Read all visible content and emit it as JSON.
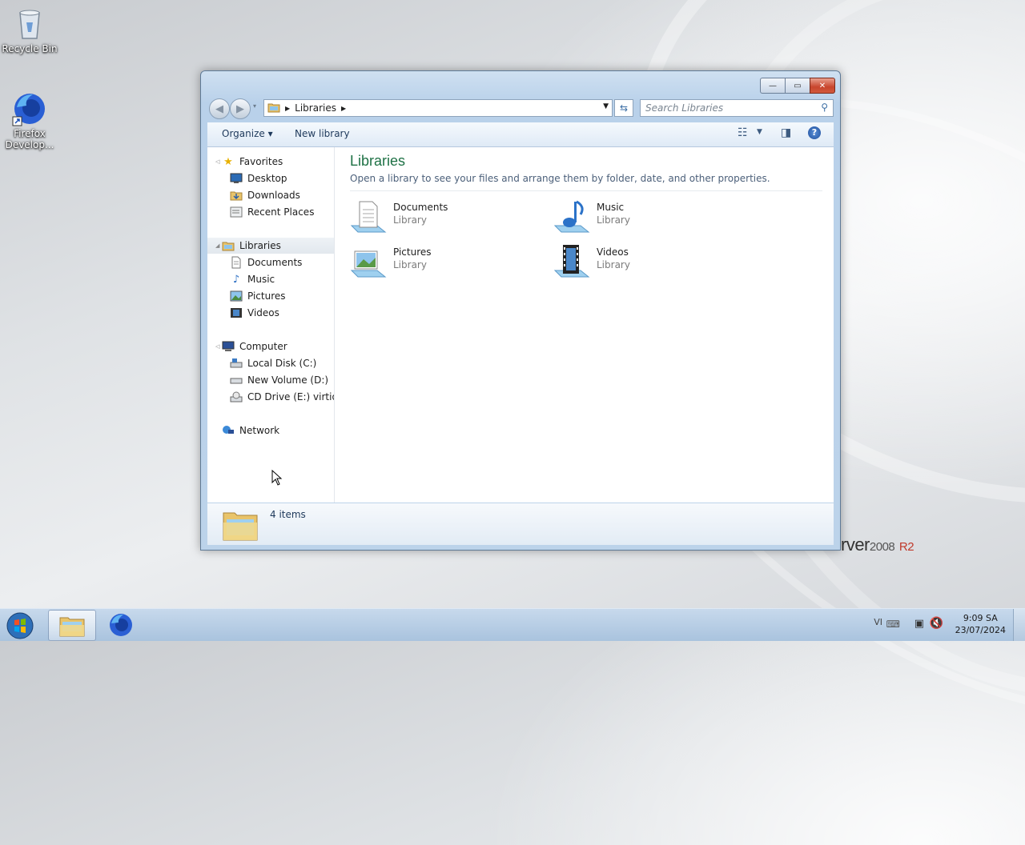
{
  "desktop": {
    "icons": [
      {
        "label": "Recycle Bin",
        "icon": "recycle-bin-icon"
      },
      {
        "label": "Firefox Develop...",
        "icon": "firefox-developer-icon"
      }
    ],
    "branding": {
      "prefix": "rver",
      "version": "2008",
      "suffix": "R2"
    }
  },
  "window": {
    "caption": {
      "minimize": "—",
      "maximize": "▭",
      "close": "✕"
    },
    "address": {
      "crumb": "Libraries"
    },
    "search": {
      "placeholder": "Search Libraries"
    },
    "toolbar": {
      "organize": "Organize ▾",
      "new_library": "New library",
      "help": "?"
    },
    "nav_pane": {
      "favorites": {
        "label": "Favorites",
        "items": [
          "Desktop",
          "Downloads",
          "Recent Places"
        ]
      },
      "libraries": {
        "label": "Libraries",
        "items": [
          "Documents",
          "Music",
          "Pictures",
          "Videos"
        ]
      },
      "computer": {
        "label": "Computer",
        "items": [
          "Local Disk (C:)",
          "New Volume (D:)",
          "CD Drive (E:) virtio-v"
        ]
      },
      "network": {
        "label": "Network"
      }
    },
    "main": {
      "title": "Libraries",
      "subtitle": "Open a library to see your files and arrange them by folder, date, and other properties.",
      "libraries": [
        {
          "name": "Documents",
          "type": "Library"
        },
        {
          "name": "Music",
          "type": "Library"
        },
        {
          "name": "Pictures",
          "type": "Library"
        },
        {
          "name": "Videos",
          "type": "Library"
        }
      ]
    },
    "details": {
      "count": "4 items"
    }
  },
  "taskbar": {
    "language": "VI",
    "time": "9:09 SA",
    "date": "23/07/2024"
  },
  "colors": {
    "heading": "#1e7145",
    "link": "#1e395b",
    "close_button": "#c8452d"
  }
}
